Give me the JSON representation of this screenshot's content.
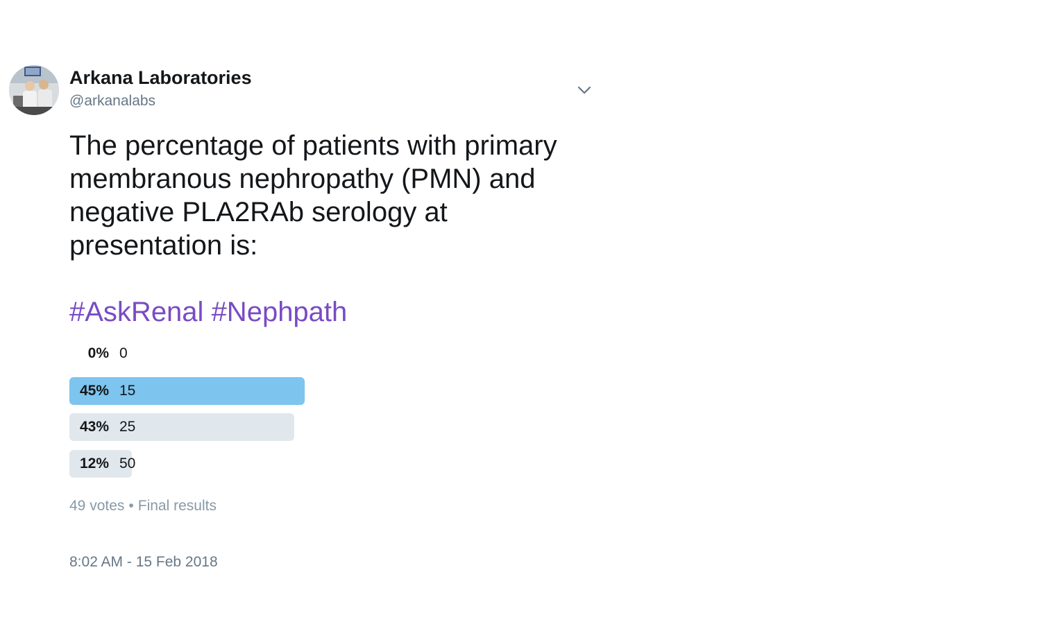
{
  "author": {
    "name": "Arkana Laboratories",
    "handle": "@arkanalabs"
  },
  "tweet": {
    "text": "The percentage of patients with primary\nmembranous nephropathy (PMN) and\nnegative PLA2RAb serology at\npresentation is:",
    "hashtags": [
      "#AskRenal",
      "#Nephpath"
    ],
    "timestamp": "8:02 AM - 15 Feb 2018"
  },
  "icons": {
    "avatar": "avatar-photo",
    "menu": "chevron-down-icon"
  },
  "colors": {
    "hashtag": "#794bc4",
    "winner_bar": "#7dc4ee",
    "bar": "#e1e8ed"
  },
  "poll": {
    "options": [
      {
        "percent": "0%",
        "label": "0",
        "fraction": 0.0,
        "winner": false
      },
      {
        "percent": "45%",
        "label": "15",
        "fraction": 0.45,
        "winner": true
      },
      {
        "percent": "43%",
        "label": "25",
        "fraction": 0.43,
        "winner": false
      },
      {
        "percent": "12%",
        "label": "50",
        "fraction": 0.12,
        "winner": false
      }
    ],
    "votes": "49 votes",
    "separator": "•",
    "status": "Final results"
  }
}
